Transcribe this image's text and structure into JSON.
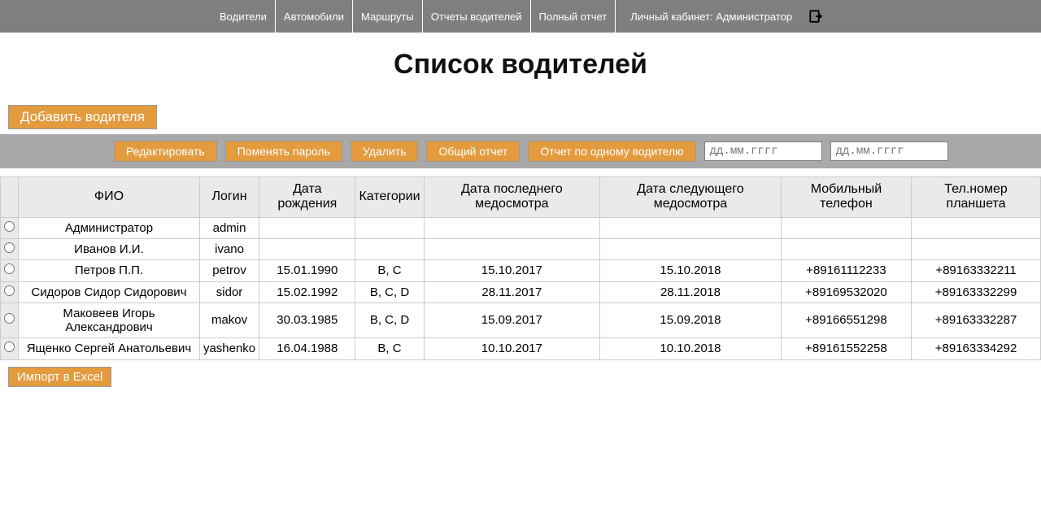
{
  "nav": {
    "items": [
      "Водители",
      "Автомобили",
      "Маршруты",
      "Отчеты водителей",
      "Полный отчет"
    ],
    "account_label": "Личный кабинет: Администратор"
  },
  "page_title": "Список водителей",
  "buttons": {
    "add_driver": "Добавить водителя",
    "edit": "Редактировать",
    "change_password": "Поменять пароль",
    "delete": "Удалить",
    "general_report": "Общий отчет",
    "single_report": "Отчет по одному водителю",
    "import_excel": "Импорт в Excel"
  },
  "date_inputs": {
    "from_placeholder": "дд.мм.гггг",
    "to_placeholder": "дд.мм.гггг"
  },
  "table": {
    "headers": {
      "fio": "ФИО",
      "login": "Логин",
      "dob": "Дата рождения",
      "categories": "Категории",
      "last_med": "Дата последнего медосмотра",
      "next_med": "Дата следующего медосмотра",
      "mobile": "Мобильный телефон",
      "tablet": "Тел.номер планшета"
    },
    "rows": [
      {
        "fio": "Администратор",
        "login": "admin",
        "dob": "",
        "categories": "",
        "last_med": "",
        "next_med": "",
        "mobile": "",
        "tablet": ""
      },
      {
        "fio": "Иванов И.И.",
        "login": "ivano",
        "dob": "",
        "categories": "",
        "last_med": "",
        "next_med": "",
        "mobile": "",
        "tablet": ""
      },
      {
        "fio": "Петров П.П.",
        "login": "petrov",
        "dob": "15.01.1990",
        "categories": "B, C",
        "last_med": "15.10.2017",
        "next_med": "15.10.2018",
        "mobile": "+89161112233",
        "tablet": "+89163332211"
      },
      {
        "fio": "Сидоров Сидор Сидорович",
        "login": "sidor",
        "dob": "15.02.1992",
        "categories": "B, C, D",
        "last_med": "28.11.2017",
        "next_med": "28.11.2018",
        "mobile": "+89169532020",
        "tablet": "+89163332299"
      },
      {
        "fio": "Маковеев Игорь Александрович",
        "login": "makov",
        "dob": "30.03.1985",
        "categories": "B, C, D",
        "last_med": "15.09.2017",
        "next_med": "15.09.2018",
        "mobile": "+89166551298",
        "tablet": "+89163332287"
      },
      {
        "fio": "Ященко Сергей Анатольевич",
        "login": "yashenko",
        "dob": "16.04.1988",
        "categories": "B, C",
        "last_med": "10.10.2017",
        "next_med": "10.10.2018",
        "mobile": "+89161552258",
        "tablet": "+89163334292"
      }
    ]
  }
}
